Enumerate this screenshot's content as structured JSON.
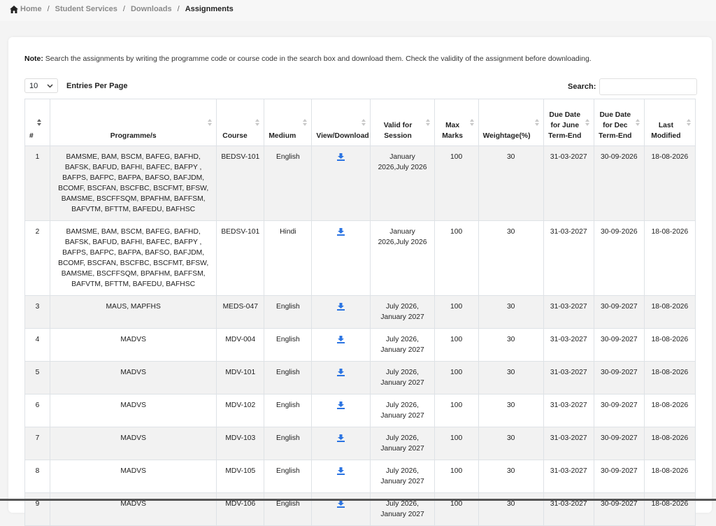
{
  "breadcrumb": {
    "home": "Home",
    "student_services": "Student Services",
    "downloads": "Downloads",
    "current": "Assignments",
    "separator": "/"
  },
  "note": {
    "label": "Note:",
    "text": " Search the assignments by writing the programme code or course code in the search box and download them. Check the validity of the assignment before downloading."
  },
  "entries": {
    "value": "10",
    "label": "Entries Per Page"
  },
  "search": {
    "label": "Search:",
    "value": ""
  },
  "colors": {
    "download_icon": "#2b74e2",
    "stripe": "#f2f2f2",
    "border": "#dee2e6"
  },
  "table": {
    "headers": {
      "num": "#",
      "programme": "Programme/s",
      "course": "Course",
      "medium": "Medium",
      "download": "View/Download",
      "valid": "Valid for Session",
      "max_marks": "Max Marks",
      "weightage": "Weightage(%)",
      "due_june": "Due Date for June Term-End",
      "due_dec": "Due Date for Dec Term-End",
      "modified": "Last Modified"
    },
    "rows": [
      {
        "num": "1",
        "programme": "BAMSME, BAM, BSCM, BAFEG, BAFHD, BAFSK, BAFUD, BAFHI, BAFEC, BAFPY , BAFPS, BAFPC, BAFPA, BAFSO, BAFJDM, BCOMF, BSCFAN, BSCFBC, BSCFMT, BFSW, BAMSME, BSCFFSQM, BPAFHM, BAFFSM, BAFVTM, BFTTM, BAFEDU, BAFHSC",
        "course": "BEDSV-101",
        "medium": "English",
        "valid": "January 2026,July 2026",
        "max": "100",
        "weight": "30",
        "due_june": "31-03-2027",
        "due_dec": "30-09-2026",
        "modified": "18-08-2026"
      },
      {
        "num": "2",
        "programme": "BAMSME, BAM, BSCM, BAFEG, BAFHD, BAFSK, BAFUD, BAFHI, BAFEC, BAFPY , BAFPS, BAFPC, BAFPA, BAFSO, BAFJDM, BCOMF, BSCFAN, BSCFBC, BSCFMT, BFSW, BAMSME, BSCFFSQM, BPAFHM, BAFFSM, BAFVTM, BFTTM, BAFEDU, BAFHSC",
        "course": "BEDSV-101",
        "medium": "Hindi",
        "valid": "January 2026,July 2026",
        "max": "100",
        "weight": "30",
        "due_june": "31-03-2027",
        "due_dec": "30-09-2026",
        "modified": "18-08-2026"
      },
      {
        "num": "3",
        "programme": "MAUS, MAPFHS",
        "course": "MEDS-047",
        "medium": "English",
        "valid": "July 2026, January 2027",
        "max": "100",
        "weight": "30",
        "due_june": "31-03-2027",
        "due_dec": "30-09-2027",
        "modified": "18-08-2026"
      },
      {
        "num": "4",
        "programme": "MADVS",
        "course": "MDV-004",
        "medium": "English",
        "valid": "July 2026, January 2027",
        "max": "100",
        "weight": "30",
        "due_june": "31-03-2027",
        "due_dec": "30-09-2027",
        "modified": "18-08-2026"
      },
      {
        "num": "5",
        "programme": "MADVS",
        "course": "MDV-101",
        "medium": "English",
        "valid": "July 2026, January 2027",
        "max": "100",
        "weight": "30",
        "due_june": "31-03-2027",
        "due_dec": "30-09-2027",
        "modified": "18-08-2026"
      },
      {
        "num": "6",
        "programme": "MADVS",
        "course": "MDV-102",
        "medium": "English",
        "valid": "July 2026, January 2027",
        "max": "100",
        "weight": "30",
        "due_june": "31-03-2027",
        "due_dec": "30-09-2027",
        "modified": "18-08-2026"
      },
      {
        "num": "7",
        "programme": "MADVS",
        "course": "MDV-103",
        "medium": "English",
        "valid": "July 2026, January 2027",
        "max": "100",
        "weight": "30",
        "due_june": "31-03-2027",
        "due_dec": "30-09-2027",
        "modified": "18-08-2026"
      },
      {
        "num": "8",
        "programme": "MADVS",
        "course": "MDV-105",
        "medium": "English",
        "valid": "July 2026, January 2027",
        "max": "100",
        "weight": "30",
        "due_june": "31-03-2027",
        "due_dec": "30-09-2027",
        "modified": "18-08-2026"
      },
      {
        "num": "9",
        "programme": "MADVS",
        "course": "MDV-106",
        "medium": "English",
        "valid": "July 2026, January 2027",
        "max": "100",
        "weight": "30",
        "due_june": "31-03-2027",
        "due_dec": "30-09-2027",
        "modified": "18-08-2026"
      }
    ]
  }
}
